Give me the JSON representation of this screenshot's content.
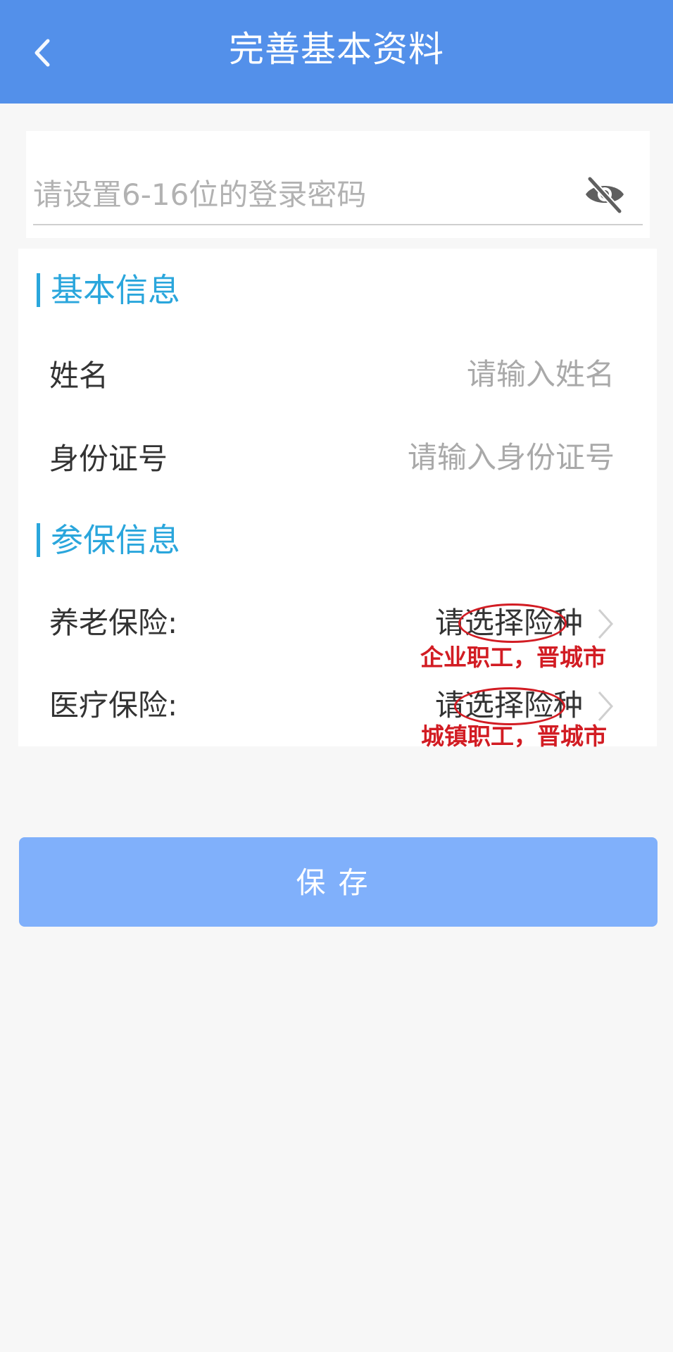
{
  "header": {
    "title": "完善基本资料",
    "back_icon": "back-arrow-icon"
  },
  "password": {
    "placeholder": "请设置6-16位的登录密码",
    "value": "",
    "visibility_icon": "eye-off-icon"
  },
  "basic_info": {
    "section_title": "基本信息",
    "name_label": "姓名",
    "name_placeholder": "请输入姓名",
    "id_label": "身份证号",
    "id_placeholder": "请输入身份证号"
  },
  "insurance_info": {
    "section_title": "参保信息",
    "pension_label": "养老保险:",
    "pension_select": "请选择险种",
    "pension_annotation": "企业职工，晋城市",
    "medical_label": "医疗保险:",
    "medical_select": "请选择险种",
    "medical_annotation": "城镇职工，晋城市"
  },
  "save_label": "保存",
  "colors": {
    "header": "#5390ea",
    "section_accent": "#2aa6dc",
    "save_button": "#80b0fb",
    "annotation": "#d21c23"
  }
}
